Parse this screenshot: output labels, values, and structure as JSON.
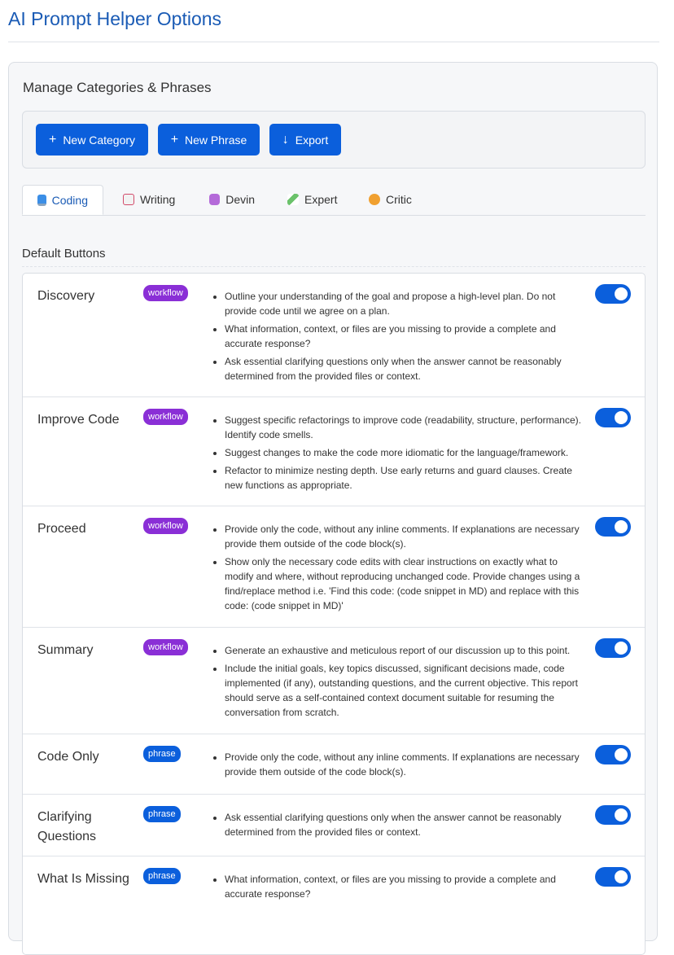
{
  "page": {
    "title": "AI Prompt Helper Options"
  },
  "panel": {
    "title": "Manage Categories & Phrases"
  },
  "toolbar": {
    "new_category": "New Category",
    "new_phrase": "New Phrase",
    "export": "Export",
    "plus_glyph": "+",
    "export_glyph": "↓"
  },
  "tabs": [
    {
      "label": "Coding",
      "icon": "laptop-icon",
      "active": true
    },
    {
      "label": "Writing",
      "icon": "memo-icon",
      "active": false
    },
    {
      "label": "Devin",
      "icon": "robot-icon",
      "active": false
    },
    {
      "label": "Expert",
      "icon": "syringe-icon",
      "active": false
    },
    {
      "label": "Critic",
      "icon": "face-icon",
      "active": false
    }
  ],
  "section": {
    "heading": "Default Buttons"
  },
  "rows": [
    {
      "name": "Discovery",
      "badge": "workflow",
      "enabled": true,
      "phrases": [
        "Outline your understanding of the goal and propose a high-level plan. Do not provide code until we agree on a plan.",
        "What information, context, or files are you missing to provide a complete and accurate response?",
        "Ask essential clarifying questions only when the answer cannot be reasonably determined from the provided files or context."
      ]
    },
    {
      "name": "Improve Code",
      "badge": "workflow",
      "enabled": true,
      "phrases": [
        "Suggest specific refactorings to improve code (readability, structure, performance). Identify code smells.",
        "Suggest changes to make the code more idiomatic for the language/framework.",
        "Refactor to minimize nesting depth. Use early returns and guard clauses. Create new functions as appropriate."
      ]
    },
    {
      "name": "Proceed",
      "badge": "workflow",
      "enabled": true,
      "phrases": [
        "Provide only the code, without any inline comments. If explanations are necessary provide them outside of the code block(s).",
        "Show only the necessary code edits with clear instructions on exactly what to modify and where, without reproducing unchanged code. Provide changes using a find/replace method i.e. 'Find this code: (code snippet in MD) and replace with this code: (code snippet in MD)'"
      ]
    },
    {
      "name": "Summary",
      "badge": "workflow",
      "enabled": true,
      "phrases": [
        "Generate an exhaustive and meticulous report of our discussion up to this point.",
        "Include the initial goals, key topics discussed, significant decisions made, code implemented (if any), outstanding questions, and the current objective. This report should serve as a self-contained context document suitable for resuming the conversation from scratch."
      ]
    },
    {
      "name": "Code Only",
      "badge": "phrase",
      "enabled": true,
      "phrases": [
        "Provide only the code, without any inline comments. If explanations are necessary provide them outside of the code block(s)."
      ]
    },
    {
      "name": "Clarifying Questions",
      "badge": "phrase",
      "enabled": true,
      "phrases": [
        "Ask essential clarifying questions only when the answer cannot be reasonably determined from the provided files or context."
      ]
    },
    {
      "name": "What Is Missing",
      "badge": "phrase",
      "enabled": true,
      "phrases": [
        "What information, context, or files are you missing to provide a complete and accurate response?"
      ]
    }
  ]
}
